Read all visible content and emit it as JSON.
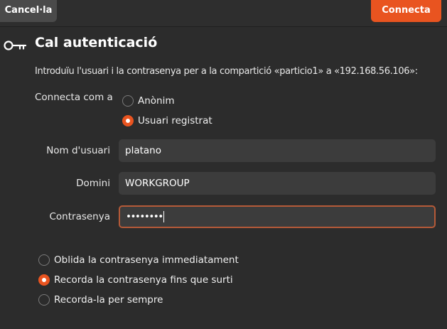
{
  "header": {
    "cancel_label": "Cancel·la",
    "connect_label": "Connecta"
  },
  "title": "Cal autenticació",
  "description": "Introduïu l'usuari i la contrasenya per a la compartició «particio1» a «192.168.56.106»:",
  "connect_as": {
    "label": "Connecta com a",
    "options": [
      {
        "label": "Anònim",
        "selected": false
      },
      {
        "label": "Usuari registrat",
        "selected": true
      }
    ]
  },
  "fields": {
    "username": {
      "label": "Nom d'usuari",
      "value": "platano"
    },
    "domain": {
      "label": "Domini",
      "value": "WORKGROUP"
    },
    "password": {
      "label": "Contrasenya",
      "value": "••••••••"
    }
  },
  "password_options": [
    {
      "label": "Oblida la contrasenya immediatament",
      "selected": false
    },
    {
      "label": "Recorda la contrasenya fins que surti",
      "selected": true
    },
    {
      "label": "Recorda-la per sempre",
      "selected": false
    }
  ],
  "icons": {
    "title_icon": "key-icon"
  },
  "colors": {
    "accent": "#e95420",
    "background": "#2c2c2c",
    "field_background": "#3c3c3c"
  }
}
